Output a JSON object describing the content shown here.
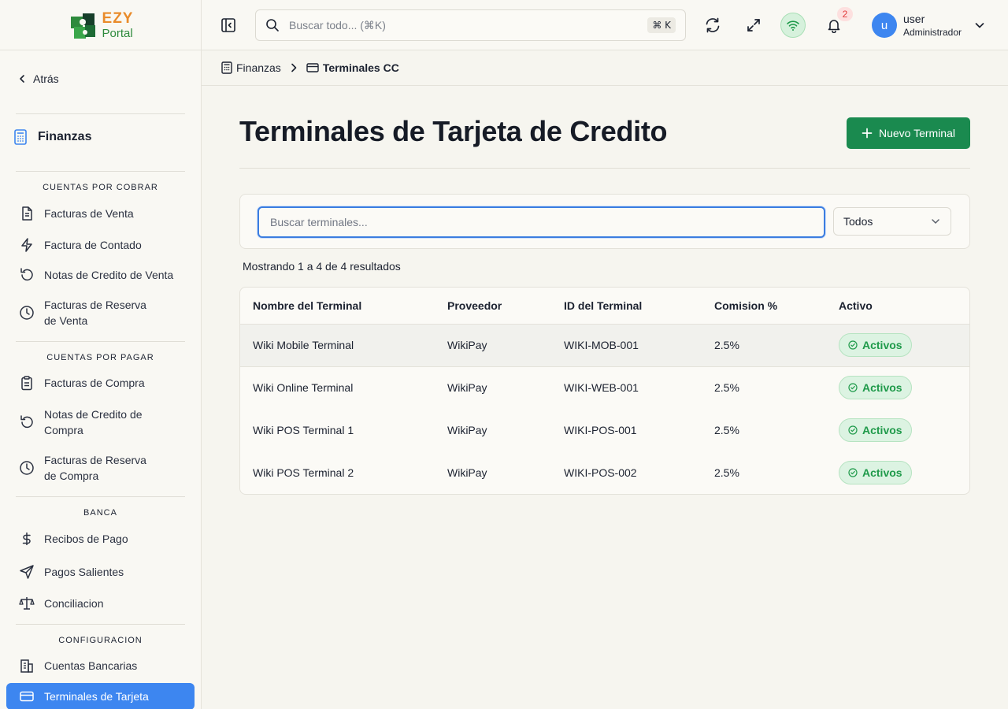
{
  "sidebar": {
    "logo": {
      "line1": "EZY",
      "line2": "Portal"
    },
    "back_label": "Atrás",
    "module_label": "Finanzas",
    "sections": {
      "receivables": "CUENTAS POR COBRAR",
      "payables": "CUENTAS POR PAGAR",
      "banking": "BANCA",
      "config": "CONFIGURACION"
    },
    "items": {
      "sales_invoices": "Facturas de Venta",
      "cash_invoice": "Factura de Contado",
      "sales_credit_notes": "Notas de Credito de Venta",
      "sales_reserve_l1": "Facturas de Reserva",
      "sales_reserve_l2": "de Venta",
      "purchase_invoices": "Facturas de Compra",
      "purchase_credit_l1": "Notas de Credito de",
      "purchase_credit_l2": "Compra",
      "purchase_reserve_l1": "Facturas de Reserva",
      "purchase_reserve_l2": "de Compra",
      "payment_receipts": "Recibos de Pago",
      "outgoing_payments": "Pagos Salientes",
      "reconciliation": "Conciliacion",
      "bank_accounts": "Cuentas Bancarias",
      "card_terminals": "Terminales de Tarjeta"
    }
  },
  "header": {
    "search_placeholder": "Buscar todo... (⌘K)",
    "search_shortcut": "⌘ K",
    "notification_count": "2",
    "user": {
      "initial": "u",
      "name": "user",
      "role": "Administrador"
    }
  },
  "breadcrumb": {
    "parent": "Finanzas",
    "current": "Terminales CC"
  },
  "main": {
    "title": "Terminales de Tarjeta de Credito",
    "new_button": "Nuevo Terminal",
    "filter_placeholder": "Buscar terminales...",
    "status_filter": "Todos",
    "results_text": "Mostrando 1 a 4 de 4 resultados",
    "columns": [
      "Nombre del Terminal",
      "Proveedor",
      "ID del Terminal",
      "Comision %",
      "Activo"
    ],
    "rows": [
      {
        "name": "Wiki Mobile Terminal",
        "provider": "WikiPay",
        "id": "WIKI-MOB-001",
        "commission": "2.5%",
        "status": "Activos"
      },
      {
        "name": "Wiki Online Terminal",
        "provider": "WikiPay",
        "id": "WIKI-WEB-001",
        "commission": "2.5%",
        "status": "Activos"
      },
      {
        "name": "Wiki POS Terminal 1",
        "provider": "WikiPay",
        "id": "WIKI-POS-001",
        "commission": "2.5%",
        "status": "Activos"
      },
      {
        "name": "Wiki POS Terminal 2",
        "provider": "WikiPay",
        "id": "WIKI-POS-002",
        "commission": "2.5%",
        "status": "Activos"
      }
    ]
  },
  "colors": {
    "accent_blue": "#3d86f0",
    "primary_green": "#1a8a4f",
    "active_badge_text": "#1f9a4a",
    "active_badge_bg": "#dcf3e2"
  }
}
